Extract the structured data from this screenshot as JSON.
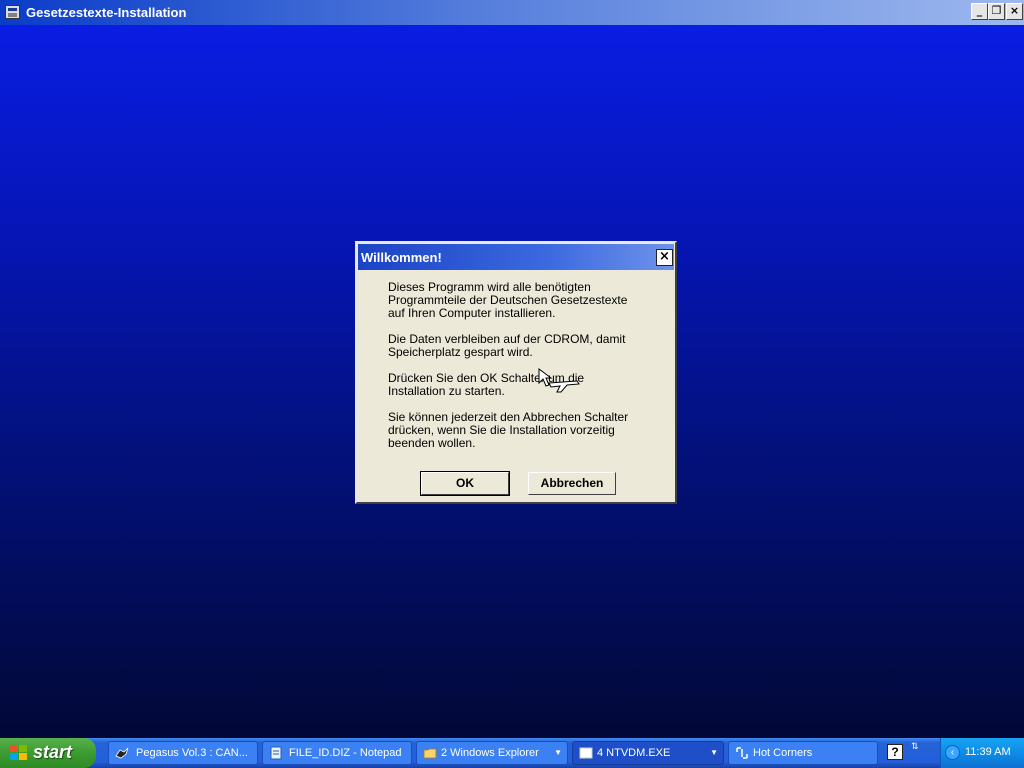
{
  "window": {
    "title": "Gesetzestexte-Installation",
    "icon": "installer-icon",
    "controls": {
      "minimize": "_",
      "restore": "❐",
      "close": "×"
    }
  },
  "dialog": {
    "title": "Willkommen!",
    "close": "×",
    "paragraphs": [
      "Dieses Programm wird alle benötigten\nProgrammteile der Deutschen Gesetzestexte\nauf Ihren Computer installieren.",
      "Die Daten verbleiben auf der CDROM, damit\nSpeicherplatz gespart wird.",
      "Drücken Sie den OK Schalter um die\nInstallation zu starten.",
      "Sie können jederzeit den Abbrechen Schalter\ndrücken, wenn Sie die Installation vorzeitig\nbeenden wollen."
    ],
    "ok_label": "OK",
    "cancel_label": "Abbrechen"
  },
  "taskbar": {
    "start_label": "start",
    "tasks": [
      {
        "label": "Pegasus Vol.3 : CAN...",
        "icon": "pegasus-icon"
      },
      {
        "label": "FILE_ID.DIZ - Notepad",
        "icon": "notepad-icon"
      },
      {
        "label": "2 Windows Explorer",
        "icon": "folder-icon"
      },
      {
        "label": "4 NTVDM.EXE",
        "icon": "console-icon"
      },
      {
        "label": "Hot Corners",
        "icon": "hot-corners-icon"
      }
    ],
    "help": "?",
    "clock": "11:39 AM"
  },
  "colors": {
    "desktop_top": "#0a1ee8",
    "desktop_bottom": "#010836",
    "dialog_bg": "#ece9d8",
    "taskbar": "#245edb",
    "start_green": "#3c9b31"
  }
}
